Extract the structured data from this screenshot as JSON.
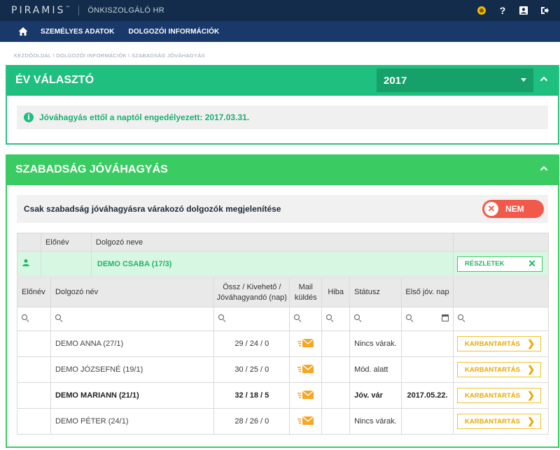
{
  "topbar": {
    "brand": "PIRAMIS",
    "brand_tm": "™",
    "app_name": "ÖNKISZOLGÁLÓ HR",
    "icons": [
      "eye-icon",
      "help-icon",
      "profile-icon",
      "logout-icon"
    ]
  },
  "nav": {
    "home_icon": "home-icon",
    "items": [
      "SZEMÉLYES ADATOK",
      "DOLGOZÓI INFORMÁCIÓK"
    ]
  },
  "breadcrumb": "KEZDŐOLDAL \\ DOLGOZÓI INFORMÁCIÓK \\ SZABADSÁG JÓVÁHAGYÁS",
  "year_panel": {
    "title": "ÉV VÁLASZTÓ",
    "selected_year": "2017",
    "info_text": "Jóváhagyás ettől a naptól engedélyezett: 2017.03.31."
  },
  "approval_panel": {
    "title": "SZABADSÁG JÓVÁHAGYÁS",
    "filter_label": "Csak szabadság jóváhagyásra várakozó dolgozók megjelenítése",
    "toggle_label": "NEM",
    "group_headers": [
      "Előnév",
      "Dolgozó neve"
    ],
    "group_row": {
      "name": "DEMO CSABA (17/3)",
      "button": "RÉSZLETEK"
    },
    "detail_headers": {
      "prefix": "Előnév",
      "name": "Dolgozó név",
      "days_line1": "Össz / Kivehető /",
      "days_line2": "Jóváhagyandó (nap)",
      "mail_line1": "Mail",
      "mail_line2": "küldés",
      "error": "Hiba",
      "status": "Státusz",
      "first_day": "Első jóv. nap"
    },
    "rows": [
      {
        "name": "DEMO ANNA (27/1)",
        "days": "29 / 24 / 0",
        "status": "Nincs várak.",
        "first_day": "",
        "button": "KARBANTARTÁS"
      },
      {
        "name": "DEMO JÓZSEFNÉ (19/1)",
        "days": "30 / 25 / 0",
        "status": "Mód. alatt",
        "first_day": "",
        "button": "KARBANTARTÁS"
      },
      {
        "name": "DEMO MARIANN (21/1)",
        "days": "32 / 18 / 5",
        "status": "Jóv. vár",
        "first_day": "2017.05.22.",
        "button": "KARBANTARTÁS"
      },
      {
        "name": "DEMO PÉTER (24/1)",
        "days": "28 / 26 / 0",
        "status": "Nincs várak.",
        "first_day": "",
        "button": "KARBANTARTÁS"
      }
    ]
  },
  "colors": {
    "topbar": "#132c4b",
    "navbar": "#19396b",
    "year_header": "#1fbf7f",
    "approval_header": "#3acc62",
    "toggle": "#f15a4a",
    "maintenance": "#f3c12a"
  }
}
